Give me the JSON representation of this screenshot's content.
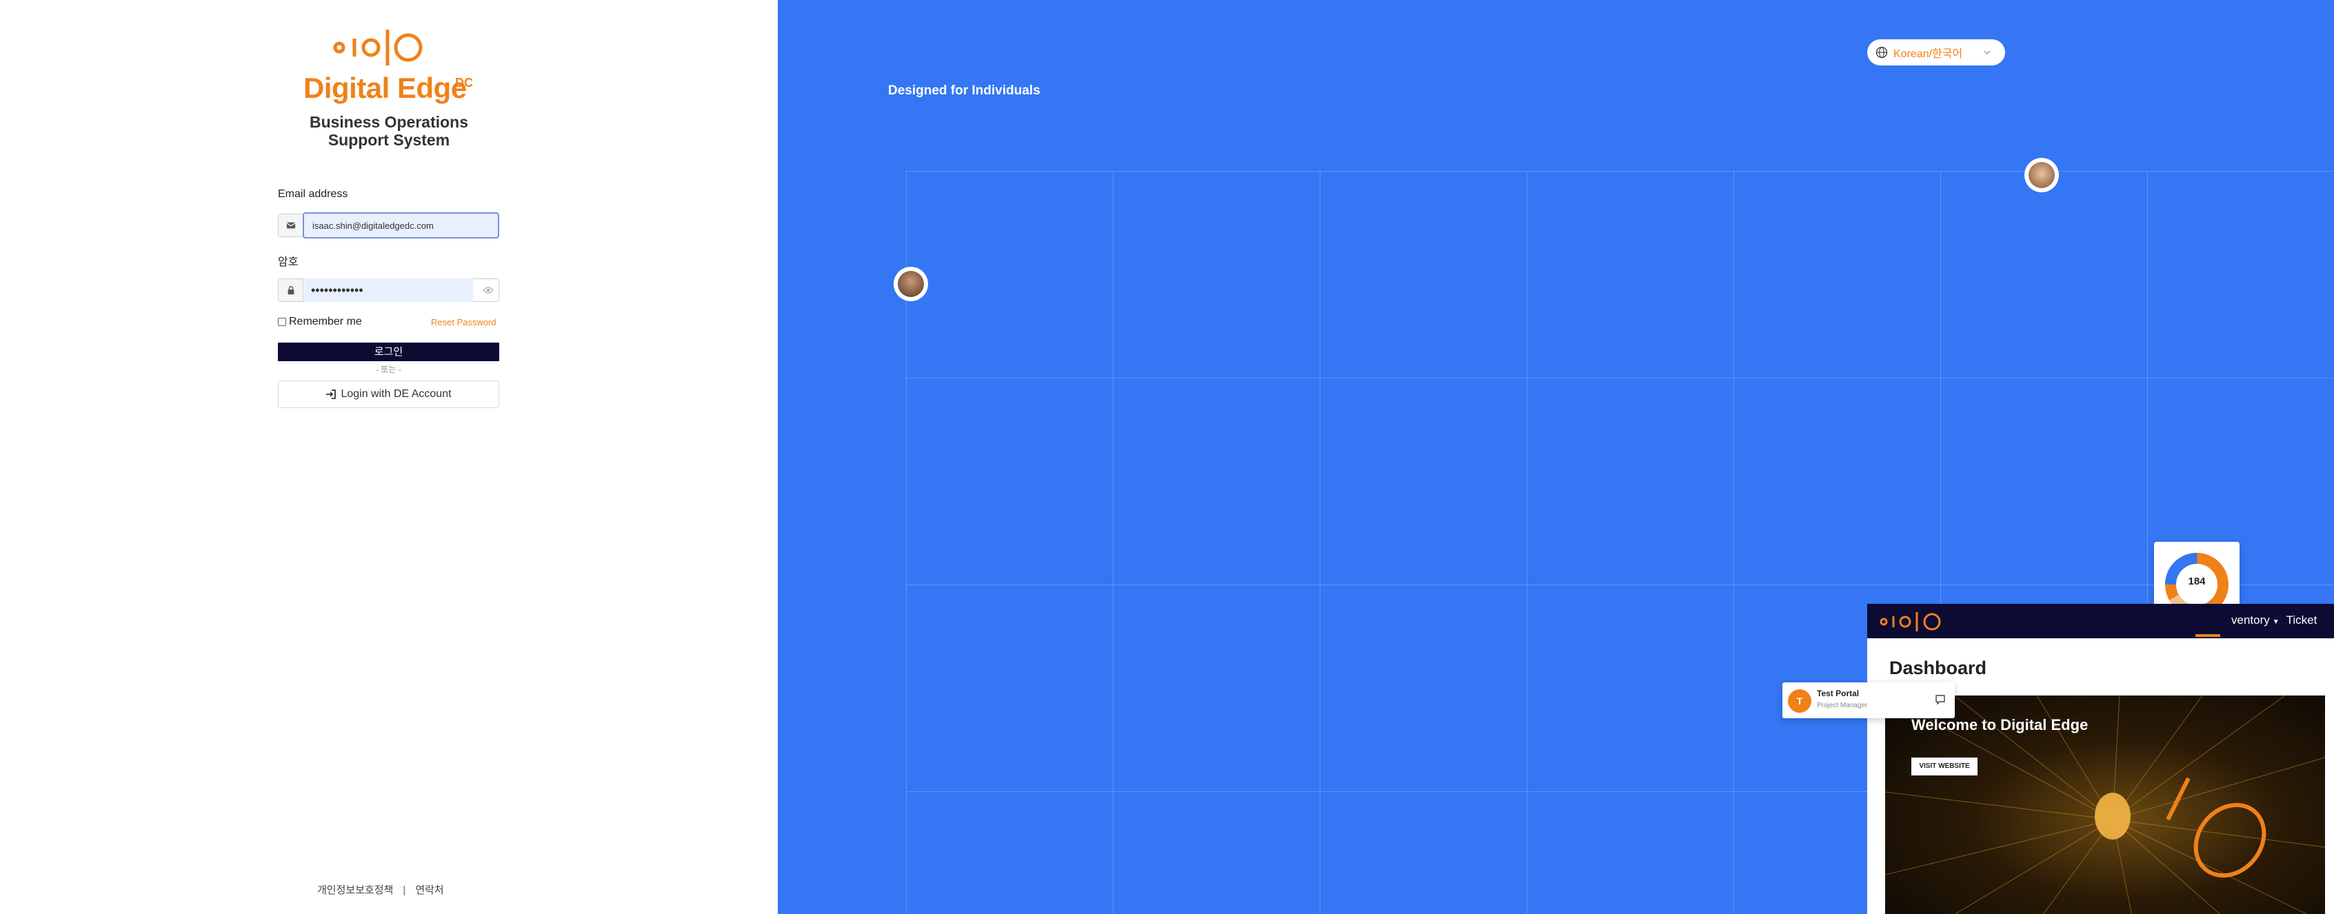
{
  "login": {
    "brand": "Digital Edge",
    "brand_suffix": "DC",
    "subtitle": "Business Operations Support System",
    "email_label": "Email address",
    "email_value": "isaac.shin@digitaledgedc.com",
    "password_label": "암호",
    "password_value": "••••••••••••",
    "remember_label": "Remember me",
    "reset_label": "Reset Password",
    "login_button": "로그인",
    "or_text": "- 또는 -",
    "de_login_button": "Login with DE Account"
  },
  "footer": {
    "privacy": "개인정보보호정책",
    "separator": "|",
    "contact": "연락처"
  },
  "showcase": {
    "tagline": "Designed for Individuals",
    "language": "Korean/한국어",
    "donut_value": "184",
    "app": {
      "nav_items": [
        "ventory",
        "Ticket"
      ],
      "page_title": "Dashboard",
      "banner_title": "Welcome to Digital Edge",
      "visit_button": "VISIT WEBSITE"
    },
    "notification": {
      "initial": "T",
      "name": "Test Portal",
      "role": "Project Manager"
    }
  },
  "colors": {
    "brand_orange": "#f08119",
    "panel_blue": "#3476f4",
    "navy": "#0b0b33"
  }
}
